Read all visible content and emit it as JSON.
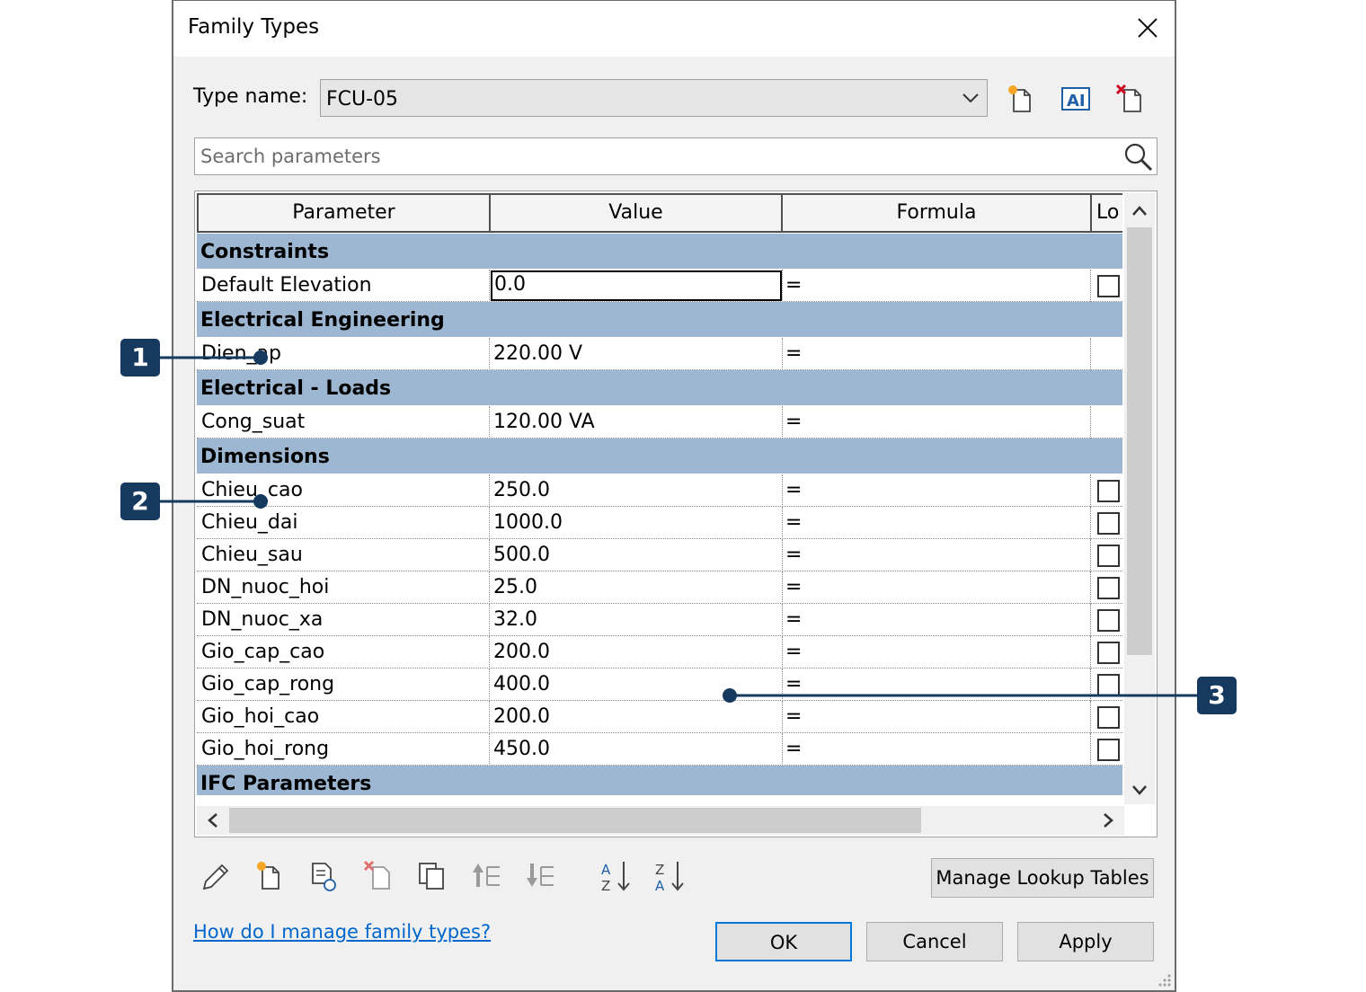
{
  "window": {
    "title": "Family Types"
  },
  "type_name": {
    "label": "Type name:",
    "value": "FCU-05"
  },
  "search": {
    "placeholder": "Search parameters"
  },
  "table": {
    "headers": {
      "parameter": "Parameter",
      "value": "Value",
      "formula": "Formula",
      "lock": "Lo"
    },
    "groups": [
      {
        "name": "Constraints",
        "rows": [
          {
            "name": "Default Elevation",
            "value": "0.0",
            "formula": "=",
            "lock": "checkbox",
            "editing": true
          }
        ]
      },
      {
        "name": "Electrical Engineering",
        "rows": [
          {
            "name": "Dien_ap",
            "value": "220.00 V",
            "formula": "=",
            "lock": "none"
          }
        ]
      },
      {
        "name": "Electrical - Loads",
        "rows": [
          {
            "name": "Cong_suat",
            "value": "120.00 VA",
            "formula": "=",
            "lock": "none"
          }
        ]
      },
      {
        "name": "Dimensions",
        "rows": [
          {
            "name": "Chieu_cao",
            "value": "250.0",
            "formula": "=",
            "lock": "checkbox"
          },
          {
            "name": "Chieu_dai",
            "value": "1000.0",
            "formula": "=",
            "lock": "checkbox"
          },
          {
            "name": "Chieu_sau",
            "value": "500.0",
            "formula": "=",
            "lock": "checkbox"
          },
          {
            "name": "DN_nuoc_hoi",
            "value": "25.0",
            "formula": "=",
            "lock": "checkbox"
          },
          {
            "name": "DN_nuoc_xa",
            "value": "32.0",
            "formula": "=",
            "lock": "checkbox"
          },
          {
            "name": "Gio_cap_cao",
            "value": "200.0",
            "formula": "=",
            "lock": "checkbox"
          },
          {
            "name": "Gio_cap_rong",
            "value": "400.0",
            "formula": "=",
            "lock": "checkbox"
          },
          {
            "name": "Gio_hoi_cao",
            "value": "200.0",
            "formula": "=",
            "lock": "checkbox"
          },
          {
            "name": "Gio_hoi_rong",
            "value": "450.0",
            "formula": "=",
            "lock": "checkbox"
          }
        ]
      },
      {
        "name": "IFC Parameters",
        "rows": []
      }
    ]
  },
  "buttons": {
    "manage_lookup": "Manage Lookup Tables",
    "ok": "OK",
    "cancel": "Cancel",
    "apply": "Apply"
  },
  "help_link": "How do I manage family types?",
  "callouts": [
    "1",
    "2",
    "3"
  ],
  "icons": {
    "type_toolbar": [
      "new-type-icon",
      "rename-type-icon",
      "delete-type-icon"
    ],
    "bottom_toolbar": [
      "edit-parameter-icon",
      "new-parameter-icon",
      "new-shared-parameter-icon",
      "delete-parameter-icon",
      "copy-parameter-icon",
      "move-up-icon",
      "move-down-icon",
      "sort-ascending-icon",
      "sort-descending-icon"
    ]
  },
  "colors": {
    "group_header": "#9db7d2",
    "callout": "#163a5f",
    "accent": "#0078d7",
    "link": "#0066cc"
  }
}
